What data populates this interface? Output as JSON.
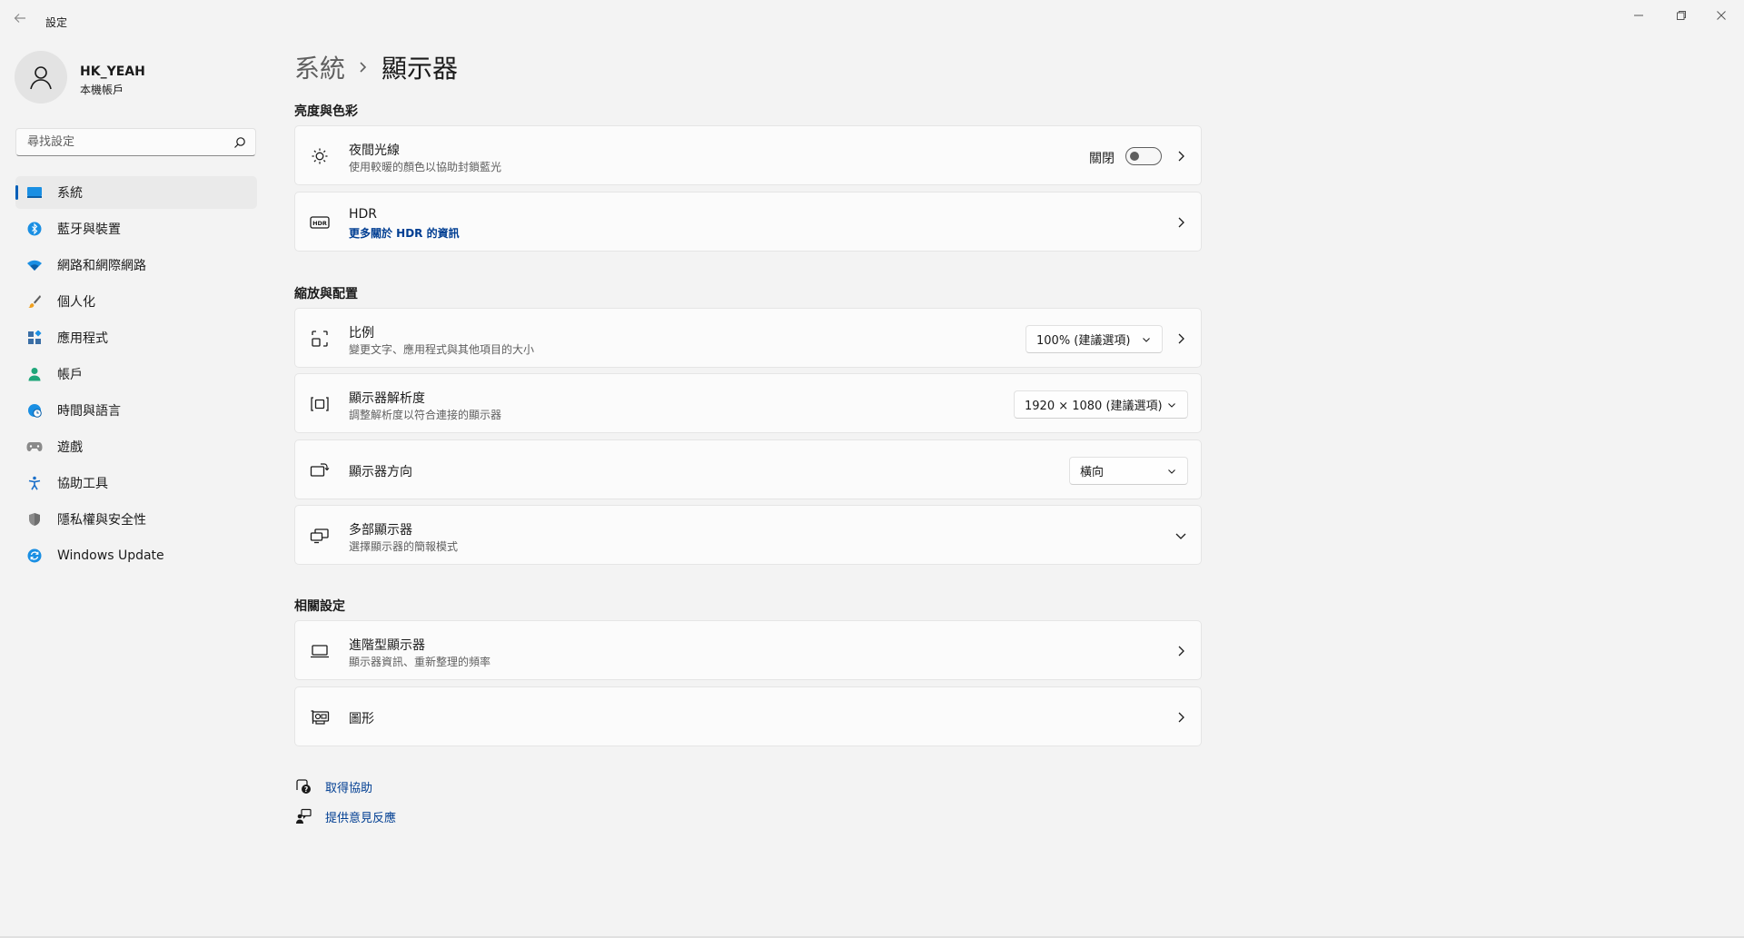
{
  "window": {
    "app_title": "設定",
    "back_icon": "back-arrow-icon",
    "controls": [
      "minimize-icon",
      "restore-icon",
      "close-icon"
    ]
  },
  "profile": {
    "name": "HK_YEAH",
    "account_type": "本機帳戶"
  },
  "search": {
    "placeholder": "尋找設定",
    "value": ""
  },
  "sidebar": {
    "items": [
      {
        "label": "系統",
        "icon": "system-monitor-icon",
        "active": true
      },
      {
        "label": "藍牙與裝置",
        "icon": "bluetooth-icon"
      },
      {
        "label": "網路和網際網路",
        "icon": "wifi-icon"
      },
      {
        "label": "個人化",
        "icon": "paintbrush-icon"
      },
      {
        "label": "應用程式",
        "icon": "apps-icon"
      },
      {
        "label": "帳戶",
        "icon": "account-icon"
      },
      {
        "label": "時間與語言",
        "icon": "time-language-icon"
      },
      {
        "label": "遊戲",
        "icon": "gamepad-icon"
      },
      {
        "label": "協助工具",
        "icon": "accessibility-icon"
      },
      {
        "label": "隱私權與安全性",
        "icon": "shield-icon"
      },
      {
        "label": "Windows Update",
        "icon": "windows-update-icon"
      }
    ]
  },
  "breadcrumb": {
    "parent": "系統",
    "current": "顯示器"
  },
  "sections": {
    "brightness": {
      "title": "亮度與色彩",
      "night_light": {
        "title": "夜間光線",
        "subtitle": "使用較暖的顏色以協助封鎖藍光",
        "toggle_label": "關閉",
        "toggle_on": false
      },
      "hdr": {
        "title": "HDR",
        "link": "更多關於 HDR 的資訊"
      }
    },
    "scale_layout": {
      "title": "縮放與配置",
      "scale": {
        "title": "比例",
        "subtitle": "變更文字、應用程式與其他項目的大小",
        "value": "100% (建議選項)"
      },
      "resolution": {
        "title": "顯示器解析度",
        "subtitle": "調整解析度以符合連接的顯示器",
        "value": "1920 × 1080 (建議選項)"
      },
      "orientation": {
        "title": "顯示器方向",
        "value": "橫向"
      },
      "multiple": {
        "title": "多部顯示器",
        "subtitle": "選擇顯示器的簡報模式"
      }
    },
    "related": {
      "title": "相關設定",
      "advanced": {
        "title": "進階型顯示器",
        "subtitle": "顯示器資訊、重新整理的頻率"
      },
      "graphics": {
        "title": "圖形"
      }
    }
  },
  "help_links": {
    "get_help": "取得協助",
    "feedback": "提供意見反應"
  },
  "colors": {
    "accent": "#005fb8",
    "link": "#003e92",
    "background": "#f3f3f3",
    "card": "#fbfbfb"
  }
}
